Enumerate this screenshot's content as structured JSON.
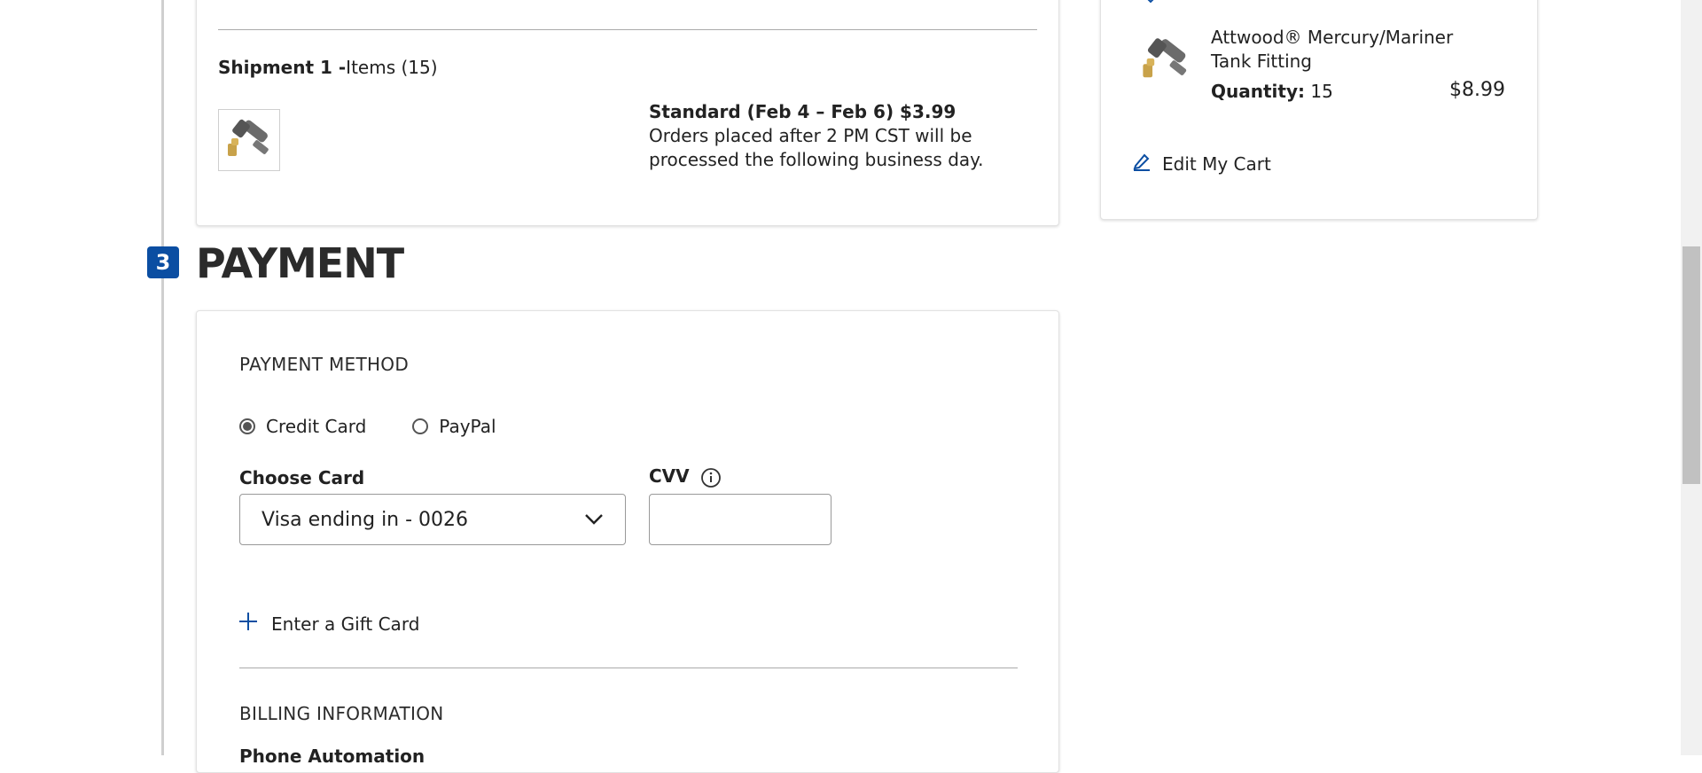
{
  "step": {
    "number": "3",
    "title": "PAYMENT"
  },
  "shipment": {
    "title_bold": "Shipment 1 -",
    "title_rest": "Items (15)",
    "method": "Standard (Feb 4 – Feb 6) $3.99",
    "note": "Orders placed after 2 PM CST will be processed the following business day."
  },
  "summary": {
    "product_name": "Attwood® Mercury/Mariner Tank Fitting",
    "qty_label": "Quantity:",
    "qty_value": "15",
    "price": "$8.99",
    "edit_label": "Edit My Cart"
  },
  "payment": {
    "method_label": "PAYMENT METHOD",
    "options": [
      "Credit Card",
      "PayPal"
    ],
    "selected_option": "Credit Card",
    "choose_card_label": "Choose Card",
    "selected_card": "Visa ending in - 0026",
    "cvv_label": "CVV",
    "cvv_value": "",
    "gift_card_label": "Enter a Gift Card",
    "billing_label": "BILLING INFORMATION",
    "partial_label": "Phone Automation"
  },
  "icons": {
    "edit": "pencil-icon",
    "info": "info-icon",
    "plus": "plus-icon",
    "chevron": "chevron-down-icon"
  },
  "colors": {
    "accent": "#0b4ea2",
    "badge": "#0b4ea2"
  }
}
